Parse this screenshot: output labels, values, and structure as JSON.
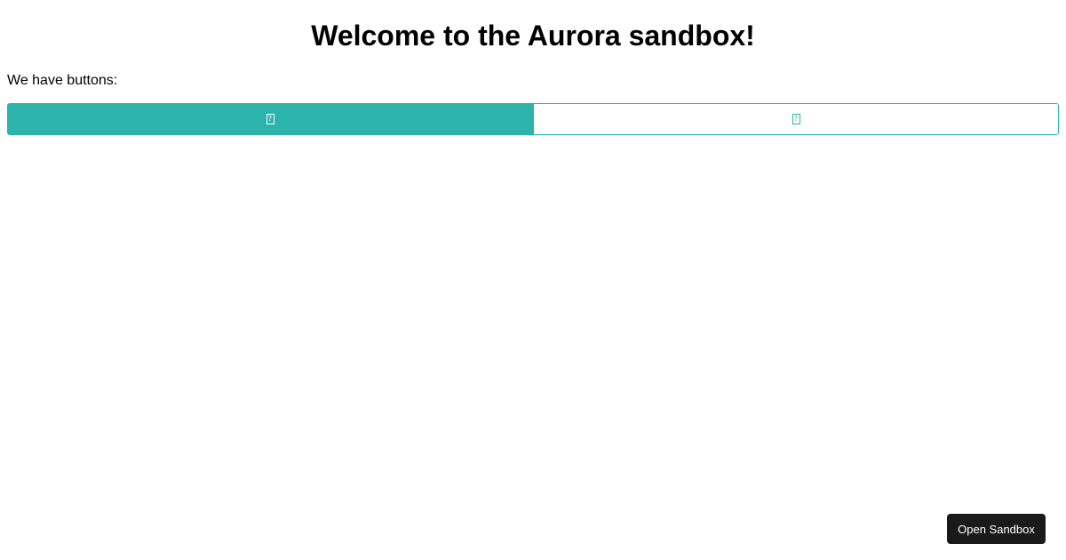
{
  "page": {
    "title": "Welcome to the Aurora sandbox!",
    "intro": "We have buttons:"
  },
  "buttons": [
    {
      "icon": "missing-glyph-icon",
      "glyph": "?",
      "style": "filled",
      "color": "#2bb3ac"
    },
    {
      "icon": "missing-glyph-icon",
      "glyph": "?",
      "style": "outline",
      "color": "#2bb3ac"
    }
  ],
  "open_sandbox": {
    "label": "Open Sandbox",
    "background": "#1a1a1a"
  }
}
